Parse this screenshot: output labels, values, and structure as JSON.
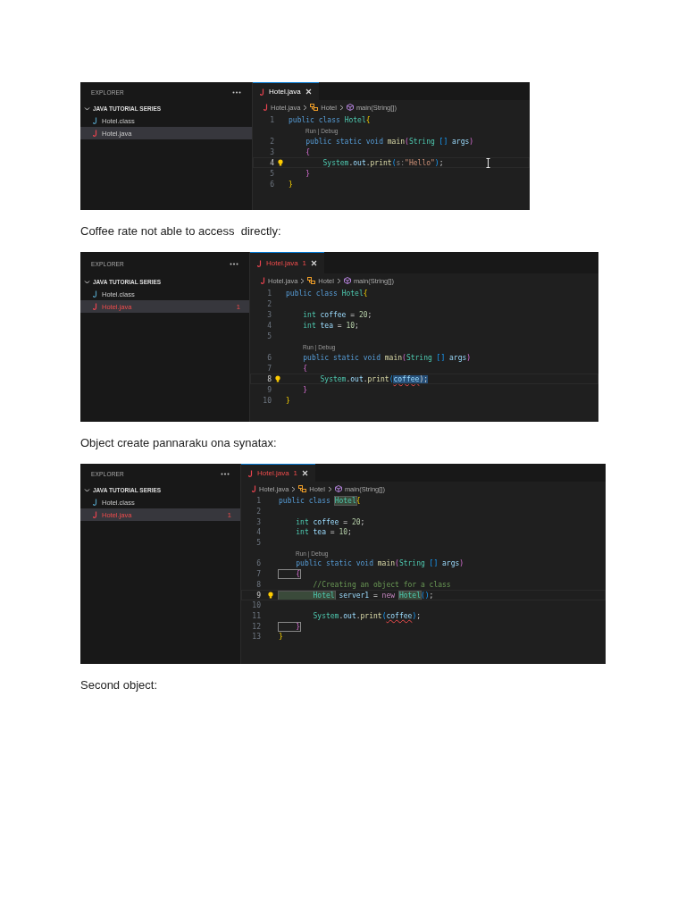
{
  "blocks": [
    {
      "kind": "screenshot",
      "mouse_pointer": true,
      "explorer": {
        "title": "EXPLORER",
        "folder": "JAVA TUTORIAL SERIES",
        "expanded": true,
        "files": [
          {
            "name": "Hotel.class",
            "kind": "class",
            "selected": false,
            "error": false
          },
          {
            "name": "Hotel.java",
            "kind": "java",
            "selected": true,
            "error": false
          }
        ]
      },
      "tab": {
        "label": "Hotel.java",
        "error": false
      },
      "breadcrumbs": [
        {
          "label": "Hotel.java",
          "kind": "file"
        },
        {
          "label": "Hotel",
          "kind": "class"
        },
        {
          "label": "main(String[])",
          "kind": "method"
        }
      ],
      "lines": [
        {
          "kind": "code",
          "number": "1",
          "current": false,
          "tokens": [
            {
              "text": "public class ",
              "kind": "keyword"
            },
            {
              "text": "Hotel",
              "kind": "type"
            },
            {
              "text": "{",
              "kind": "brace"
            }
          ]
        },
        {
          "kind": "lens",
          "text": "Run | Debug"
        },
        {
          "kind": "code",
          "number": "2",
          "current": false,
          "tokens": [
            {
              "text": "    public static void ",
              "kind": "keyword"
            },
            {
              "text": "main",
              "kind": "function"
            },
            {
              "text": "(",
              "kind": "paren"
            },
            {
              "text": "String ",
              "kind": "type"
            },
            {
              "text": "[] ",
              "kind": "bracket"
            },
            {
              "text": "args",
              "kind": "variable"
            },
            {
              "text": ")",
              "kind": "paren"
            }
          ]
        },
        {
          "kind": "code",
          "number": "3",
          "current": false,
          "tokens": [
            {
              "text": "    {",
              "kind": "paren"
            }
          ]
        },
        {
          "kind": "code",
          "number": "4",
          "current": true,
          "tokens": [
            {
              "text": "        System",
              "kind": "type"
            },
            {
              "text": ".",
              "kind": "plain"
            },
            {
              "text": "out",
              "kind": "variable"
            },
            {
              "text": ".",
              "kind": "plain"
            },
            {
              "text": "print",
              "kind": "function"
            },
            {
              "text": "(",
              "kind": "bracket"
            },
            {
              "text": "s:",
              "kind": "hint"
            },
            {
              "text": "\"Hello\"",
              "kind": "string"
            },
            {
              "text": ")",
              "kind": "bracket"
            },
            {
              "text": ";",
              "kind": "plain"
            }
          ]
        },
        {
          "kind": "code",
          "number": "5",
          "current": false,
          "tokens": [
            {
              "text": "    }",
              "kind": "paren"
            }
          ]
        },
        {
          "kind": "code",
          "number": "6",
          "current": false,
          "tokens": [
            {
              "text": "}",
              "kind": "brace"
            }
          ]
        }
      ]
    },
    {
      "kind": "caption",
      "text": "Coffee rate not able to access  directly:"
    },
    {
      "kind": "screenshot",
      "explorer": {
        "title": "EXPLORER",
        "folder": "JAVA TUTORIAL SERIES",
        "expanded": true,
        "files": [
          {
            "name": "Hotel.class",
            "kind": "class",
            "selected": false,
            "error": false
          },
          {
            "name": "Hotel.java",
            "kind": "java",
            "selected": true,
            "error": true,
            "problems": "1"
          }
        ]
      },
      "tab": {
        "label": "Hotel.java",
        "error": true,
        "problems": "1"
      },
      "breadcrumbs": [
        {
          "label": "Hotel.java",
          "kind": "file"
        },
        {
          "label": "Hotel",
          "kind": "class"
        },
        {
          "label": "main(String[])",
          "kind": "method"
        }
      ],
      "lines": [
        {
          "kind": "code",
          "number": "1",
          "current": false,
          "tokens": [
            {
              "text": "public class ",
              "kind": "keyword"
            },
            {
              "text": "Hotel",
              "kind": "type"
            },
            {
              "text": "{",
              "kind": "brace"
            }
          ]
        },
        {
          "kind": "code",
          "number": "2",
          "current": false
        },
        {
          "kind": "code",
          "number": "3",
          "current": false,
          "tokens": [
            {
              "text": "    int ",
              "kind": "type"
            },
            {
              "text": "coffee",
              "kind": "variable"
            },
            {
              "text": " = ",
              "kind": "plain"
            },
            {
              "text": "20",
              "kind": "number"
            },
            {
              "text": ";",
              "kind": "plain"
            }
          ]
        },
        {
          "kind": "code",
          "number": "4",
          "current": false,
          "tokens": [
            {
              "text": "    int ",
              "kind": "type"
            },
            {
              "text": "tea",
              "kind": "variable"
            },
            {
              "text": " = ",
              "kind": "plain"
            },
            {
              "text": "10",
              "kind": "number"
            },
            {
              "text": ";",
              "kind": "plain"
            }
          ]
        },
        {
          "kind": "code",
          "number": "5",
          "current": false
        },
        {
          "kind": "lens",
          "text": "Run | Debug"
        },
        {
          "kind": "code",
          "number": "6",
          "current": false,
          "tokens": [
            {
              "text": "    public static void ",
              "kind": "keyword"
            },
            {
              "text": "main",
              "kind": "function"
            },
            {
              "text": "(",
              "kind": "paren"
            },
            {
              "text": "String ",
              "kind": "type"
            },
            {
              "text": "[] ",
              "kind": "bracket"
            },
            {
              "text": "args",
              "kind": "variable"
            },
            {
              "text": ")",
              "kind": "paren"
            }
          ]
        },
        {
          "kind": "code",
          "number": "7",
          "current": false,
          "tokens": [
            {
              "text": "    {",
              "kind": "paren"
            }
          ]
        },
        {
          "kind": "code",
          "number": "8",
          "current": true,
          "tokens": [
            {
              "text": "        System",
              "kind": "type"
            },
            {
              "text": ".",
              "kind": "plain"
            },
            {
              "text": "out",
              "kind": "variable"
            },
            {
              "text": ".",
              "kind": "plain"
            },
            {
              "text": "print",
              "kind": "function"
            },
            {
              "text": "(",
              "kind": "bracket"
            },
            {
              "text": "coffee",
              "kind": "variable",
              "selected": true,
              "error": true
            },
            {
              "text": ");",
              "kind": "plain",
              "selected": true
            }
          ]
        },
        {
          "kind": "code",
          "number": "9",
          "current": false,
          "tokens": [
            {
              "text": "    }",
              "kind": "paren"
            }
          ]
        },
        {
          "kind": "code",
          "number": "10",
          "current": false,
          "tokens": [
            {
              "text": "}",
              "kind": "brace"
            }
          ]
        }
      ]
    },
    {
      "kind": "caption",
      "text": "Object create pannaraku ona synatax:"
    },
    {
      "kind": "screenshot",
      "explorer": {
        "title": "EXPLORER",
        "folder": "JAVA TUTORIAL SERIES",
        "expanded": true,
        "files": [
          {
            "name": "Hotel.class",
            "kind": "class",
            "selected": false,
            "error": false
          },
          {
            "name": "Hotel.java",
            "kind": "java",
            "selected": true,
            "error": true,
            "problems": "1"
          }
        ]
      },
      "tab": {
        "label": "Hotel.java",
        "error": true,
        "problems": "1"
      },
      "breadcrumbs": [
        {
          "label": "Hotel.java",
          "kind": "file"
        },
        {
          "label": "Hotel",
          "kind": "class"
        },
        {
          "label": "main(String[])",
          "kind": "method"
        }
      ],
      "lines": [
        {
          "kind": "code",
          "number": "1",
          "current": false,
          "tokens": [
            {
              "text": "public class ",
              "kind": "keyword"
            },
            {
              "text": "Hotel",
              "kind": "type",
              "reference": true
            },
            {
              "text": "{",
              "kind": "brace"
            }
          ]
        },
        {
          "kind": "code",
          "number": "2",
          "current": false
        },
        {
          "kind": "code",
          "number": "3",
          "current": false,
          "tokens": [
            {
              "text": "    int ",
              "kind": "type"
            },
            {
              "text": "coffee",
              "kind": "variable"
            },
            {
              "text": " = ",
              "kind": "plain"
            },
            {
              "text": "20",
              "kind": "number"
            },
            {
              "text": ";",
              "kind": "plain"
            }
          ]
        },
        {
          "kind": "code",
          "number": "4",
          "current": false,
          "tokens": [
            {
              "text": "    int ",
              "kind": "type"
            },
            {
              "text": "tea",
              "kind": "variable"
            },
            {
              "text": " = ",
              "kind": "plain"
            },
            {
              "text": "10",
              "kind": "number"
            },
            {
              "text": ";",
              "kind": "plain"
            }
          ]
        },
        {
          "kind": "code",
          "number": "5",
          "current": false
        },
        {
          "kind": "lens",
          "text": "Run | Debug"
        },
        {
          "kind": "code",
          "number": "6",
          "current": false,
          "tokens": [
            {
              "text": "    public static void ",
              "kind": "keyword"
            },
            {
              "text": "main",
              "kind": "function"
            },
            {
              "text": "(",
              "kind": "paren"
            },
            {
              "text": "String ",
              "kind": "type"
            },
            {
              "text": "[] ",
              "kind": "bracket"
            },
            {
              "text": "args",
              "kind": "variable"
            },
            {
              "text": ")",
              "kind": "paren"
            }
          ]
        },
        {
          "kind": "code",
          "number": "7",
          "current": false,
          "tokens": [
            {
              "text": "    {",
              "kind": "paren",
              "matched": true
            }
          ]
        },
        {
          "kind": "code",
          "number": "8",
          "current": false,
          "tokens": [
            {
              "text": "        //Creating an object for a class",
              "kind": "comment"
            }
          ]
        },
        {
          "kind": "code",
          "number": "9",
          "current": true,
          "tokens": [
            {
              "text": "        Hotel",
              "kind": "type",
              "reference": true
            },
            {
              "text": " server1",
              "kind": "variable"
            },
            {
              "text": " = ",
              "kind": "plain"
            },
            {
              "text": "new ",
              "kind": "control"
            },
            {
              "text": "Hotel",
              "kind": "type",
              "reference": true
            },
            {
              "text": "()",
              "kind": "bracket"
            },
            {
              "text": ";",
              "kind": "plain"
            }
          ]
        },
        {
          "kind": "code",
          "number": "10",
          "current": false
        },
        {
          "kind": "code",
          "number": "11",
          "current": false,
          "tokens": [
            {
              "text": "        System",
              "kind": "type"
            },
            {
              "text": ".",
              "kind": "plain"
            },
            {
              "text": "out",
              "kind": "variable"
            },
            {
              "text": ".",
              "kind": "plain"
            },
            {
              "text": "print",
              "kind": "function"
            },
            {
              "text": "(",
              "kind": "bracket"
            },
            {
              "text": "coffee",
              "kind": "variable",
              "error": true
            },
            {
              "text": ")",
              "kind": "bracket"
            },
            {
              "text": ";",
              "kind": "plain"
            }
          ]
        },
        {
          "kind": "code",
          "number": "12",
          "current": false,
          "tokens": [
            {
              "text": "    }",
              "kind": "paren",
              "matched": true
            }
          ]
        },
        {
          "kind": "code",
          "number": "13",
          "current": false,
          "tokens": [
            {
              "text": "}",
              "kind": "brace"
            }
          ]
        }
      ]
    },
    {
      "kind": "caption",
      "text": "Second object:"
    }
  ]
}
